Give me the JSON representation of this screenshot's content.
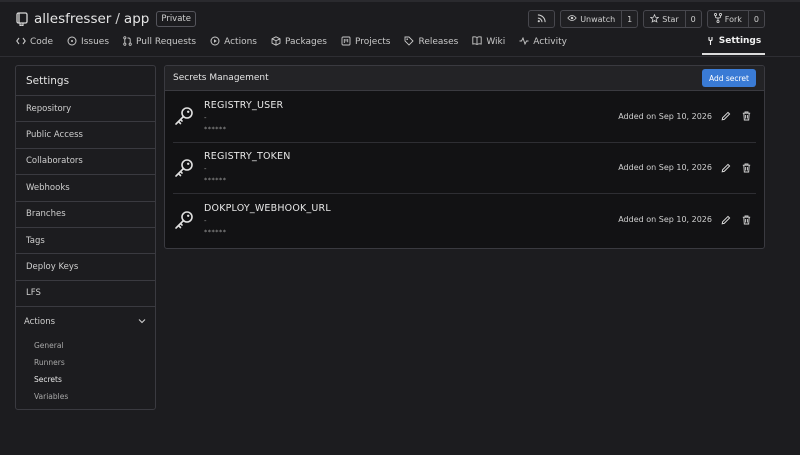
{
  "repo": {
    "owner": "allesfresser",
    "separator": "/",
    "name": "app",
    "visibility": "Private"
  },
  "actions": {
    "watch_label": "Unwatch",
    "watch_count": "1",
    "star_label": "Star",
    "star_count": "0",
    "fork_label": "Fork",
    "fork_count": "0"
  },
  "tabs": [
    {
      "label": "Code",
      "icon": "code-icon"
    },
    {
      "label": "Issues",
      "icon": "issue-icon"
    },
    {
      "label": "Pull Requests",
      "icon": "pull-request-icon"
    },
    {
      "label": "Actions",
      "icon": "play-icon"
    },
    {
      "label": "Packages",
      "icon": "package-icon"
    },
    {
      "label": "Projects",
      "icon": "project-icon"
    },
    {
      "label": "Releases",
      "icon": "tag-icon"
    },
    {
      "label": "Wiki",
      "icon": "book-icon"
    },
    {
      "label": "Activity",
      "icon": "pulse-icon"
    }
  ],
  "active_tab": {
    "label": "Settings",
    "icon": "tools-icon"
  },
  "sidebar": {
    "title": "Settings",
    "items": [
      {
        "label": "Repository"
      },
      {
        "label": "Public Access"
      },
      {
        "label": "Collaborators"
      },
      {
        "label": "Webhooks"
      },
      {
        "label": "Branches"
      },
      {
        "label": "Tags"
      },
      {
        "label": "Deploy Keys"
      },
      {
        "label": "LFS"
      }
    ],
    "actions_group": {
      "label": "Actions",
      "subitems": [
        {
          "label": "General"
        },
        {
          "label": "Runners"
        },
        {
          "label": "Secrets"
        },
        {
          "label": "Variables"
        }
      ],
      "active": "Secrets"
    }
  },
  "secrets_panel": {
    "title": "Secrets Management",
    "add_button": "Add secret",
    "secrets": [
      {
        "name": "REGISTRY_USER",
        "description": "-",
        "value": "******",
        "added": "Added on Sep 10, 2026"
      },
      {
        "name": "REGISTRY_TOKEN",
        "description": "-",
        "value": "******",
        "added": "Added on Sep 10, 2026"
      },
      {
        "name": "DOKPLOY_WEBHOOK_URL",
        "description": "-",
        "value": "******",
        "added": "Added on Sep 10, 2026"
      }
    ]
  },
  "colors": {
    "background": "#1c1c1f",
    "panel": "#121214",
    "accent": "#3a7bd5",
    "border": "#3a3a40"
  }
}
